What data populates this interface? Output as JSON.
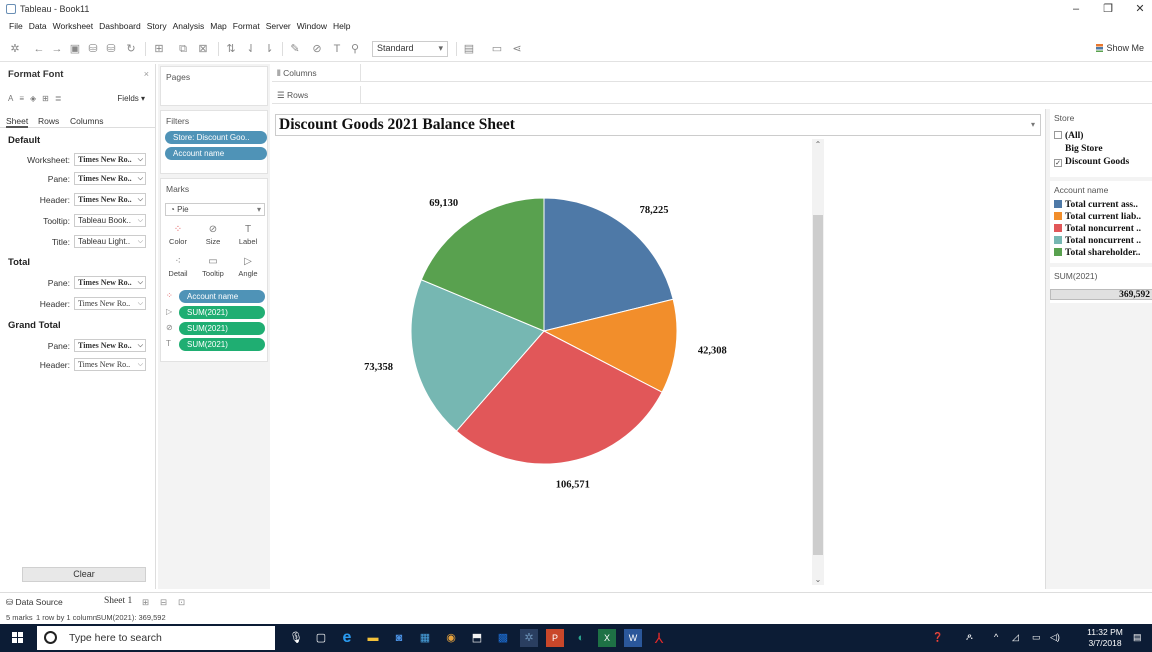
{
  "window": {
    "title": "Tableau - Book11"
  },
  "menu": [
    "File",
    "Data",
    "Worksheet",
    "Dashboard",
    "Story",
    "Analysis",
    "Map",
    "Format",
    "Server",
    "Window",
    "Help"
  ],
  "toolbar": {
    "fit_select": "Standard",
    "show_me": "Show Me"
  },
  "format_pane": {
    "title": "Format Font",
    "fields_label": "Fields ▾",
    "tabs": [
      "Sheet",
      "Rows",
      "Columns"
    ],
    "default_label": "Default",
    "worksheet_label": "Worksheet:",
    "worksheet_font": "Times New Ro..",
    "pane_label": "Pane:",
    "pane_font": "Times New Ro..",
    "header_label": "Header:",
    "header_font": "Times New Ro..",
    "tooltip_label": "Tooltip:",
    "tooltip_font": "Tableau Book..",
    "title_label": "Title:",
    "title_font": "Tableau Light..",
    "total_label": "Total",
    "total_pane_font": "Times New Ro..",
    "total_header_font": "Times New Ro..",
    "grand_total_label": "Grand Total",
    "grand_pane_font": "Times New Ro..",
    "grand_header_font": "Times New Ro..",
    "clear_label": "Clear"
  },
  "pages_label": "Pages",
  "filters": {
    "label": "Filters",
    "pills": [
      "Store: Discount Goo..",
      "Account name"
    ]
  },
  "marks": {
    "label": "Marks",
    "mark_type": "Pie",
    "buttons": [
      "Color",
      "Size",
      "Label",
      "Detail",
      "Tooltip",
      "Angle"
    ],
    "pills": [
      "Account name",
      "SUM(2021)",
      "SUM(2021)",
      "SUM(2021)"
    ]
  },
  "shelves": {
    "columns": "Columns",
    "rows": "Rows"
  },
  "view": {
    "title": "Discount Goods 2021 Balance Sheet"
  },
  "chart_data": {
    "type": "pie",
    "title": "Discount Goods 2021 Balance Sheet",
    "slices": [
      {
        "label": "Total current ass..",
        "value": 78225,
        "display": "78,225",
        "color": "#4e79a7"
      },
      {
        "label": "Total current liab..",
        "value": 42308,
        "display": "42,308",
        "color": "#f28e2b"
      },
      {
        "label": "Total noncurrent ..",
        "value": 106571,
        "display": "106,571",
        "color": "#e15759"
      },
      {
        "label": "Total noncurrent ..",
        "value": 73358,
        "display": "73,358",
        "color": "#76b7b2"
      },
      {
        "label": "Total shareholder..",
        "value": 69130,
        "display": "69,130",
        "color": "#59a14f"
      }
    ]
  },
  "legend_store": {
    "title": "Store",
    "items": [
      {
        "label": "(All)",
        "checked": false
      },
      {
        "label": "Big Store",
        "checked": false
      },
      {
        "label": "Discount Goods",
        "checked": true
      }
    ]
  },
  "legend_account": {
    "title": "Account name",
    "items": [
      {
        "label": "Total current ass..",
        "color": "#4e79a7"
      },
      {
        "label": "Total current liab..",
        "color": "#f28e2b"
      },
      {
        "label": "Total noncurrent ..",
        "color": "#e15759"
      },
      {
        "label": "Total noncurrent ..",
        "color": "#76b7b2"
      },
      {
        "label": "Total shareholder..",
        "color": "#59a14f"
      }
    ]
  },
  "sum_card": {
    "title": "SUM(2021)",
    "value": "369,592"
  },
  "bottom_tabs": {
    "data_source": "Data Source",
    "sheet": "Sheet 1"
  },
  "status": {
    "marks": "5 marks",
    "rows": "1 row by 1 column",
    "sum": "SUM(2021): 369,592"
  },
  "taskbar": {
    "search_placeholder": "Type here to search",
    "time": "11:32 PM",
    "date": "3/7/2018"
  }
}
